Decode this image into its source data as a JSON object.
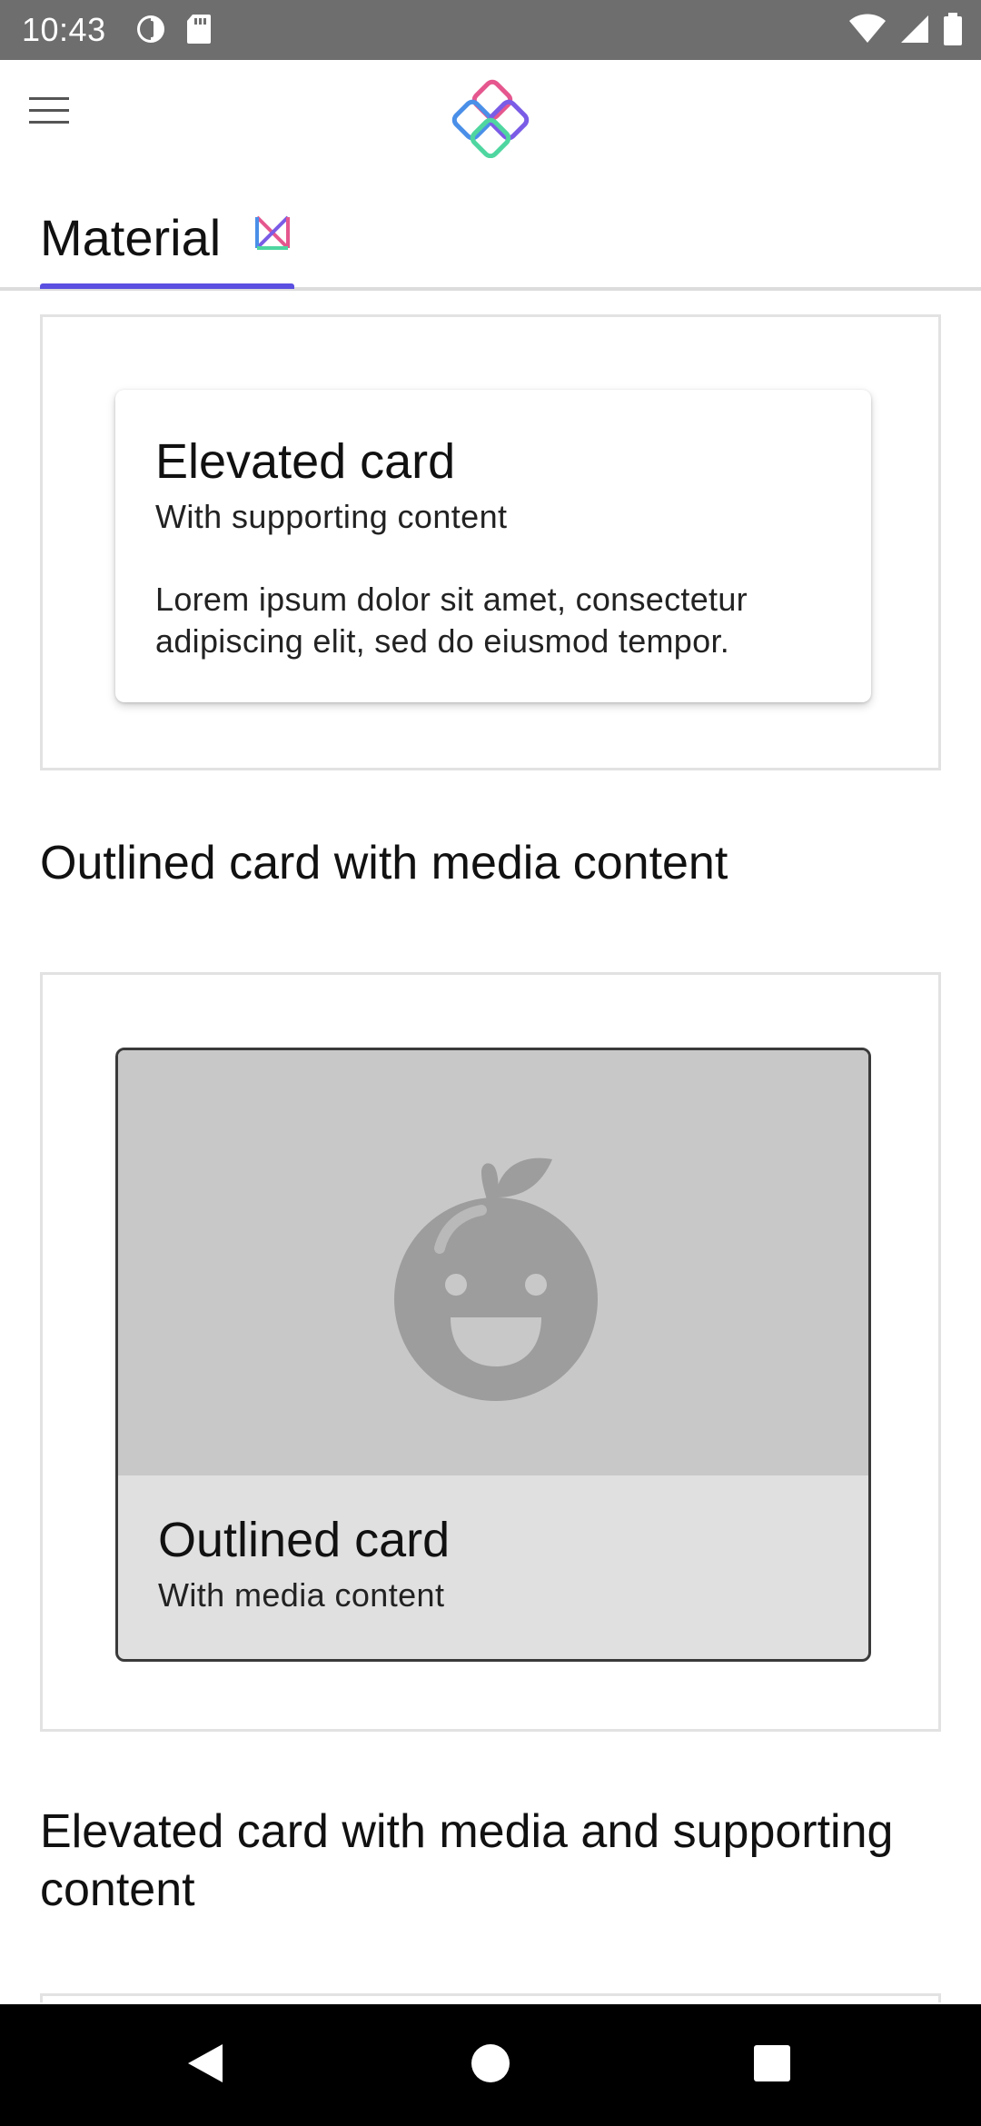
{
  "status_bar": {
    "time": "10:43",
    "left_icons": [
      "data-saver-icon",
      "sd-card-icon"
    ],
    "right_icons": [
      "wifi-icon",
      "cell-signal-icon",
      "battery-icon"
    ]
  },
  "app_bar": {
    "menu_icon": "hamburger-menu-icon",
    "logo_icon": "compose-catalog-logo"
  },
  "tabs": {
    "active_label": "Material",
    "active_icon": "material-logo-icon"
  },
  "elevated_card": {
    "title": "Elevated card",
    "subtitle": "With supporting content",
    "body": "Lorem ipsum dolor sit amet, consectetur adipiscing elit, sed do eiusmod tempor."
  },
  "outlined_section": {
    "heading": "Outlined card with media content"
  },
  "outlined_card": {
    "media_icon": "fruit-face-placeholder-icon",
    "title": "Outlined card",
    "subtitle": "With media content"
  },
  "elevated_media_section": {
    "heading": "Elevated card with media and supporting content"
  },
  "nav_bar": {
    "buttons": [
      "back-icon",
      "home-icon",
      "recents-icon"
    ]
  },
  "colors": {
    "status_bar": "#6e6e6e",
    "tab_indicator": "#5a4fe0",
    "media_placeholder": "#c8c8c8",
    "card_footer": "#e0e0e0"
  }
}
